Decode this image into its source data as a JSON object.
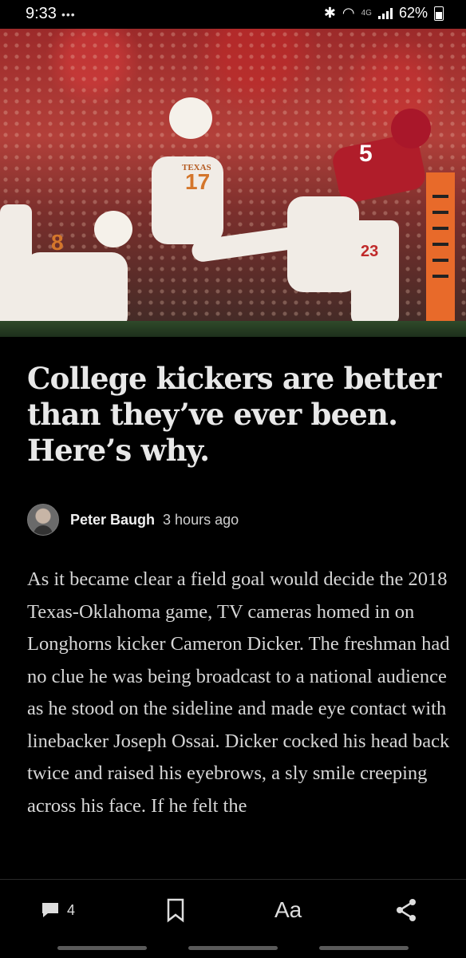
{
  "status_bar": {
    "time": "9:33",
    "notification_dots": "•••",
    "network": "4G",
    "battery": "62%"
  },
  "hero": {
    "description_icons": [
      "football-field-goal-photo"
    ],
    "jersey_numbers": [
      "17",
      "8",
      "5",
      "23"
    ],
    "jersey_text": "TEXAS"
  },
  "article": {
    "headline": "College kickers are better than they’ve ever been. Here’s why.",
    "author": "Peter Baugh",
    "time_ago": "3 hours ago",
    "body": "As it became clear a field goal would decide the 2018 Texas-Oklahoma game, TV cameras homed in on Longhorns kicker Cameron Dicker. The freshman had no clue he was being broadcast to a national audience as he stood on the sideline and made eye contact with linebacker Joseph Ossai. Dicker cocked his head back twice and raised his eyebrows, a sly smile creeping across his face. If he felt the"
  },
  "bottom_bar": {
    "comments_count": "4",
    "font_label": "Aa",
    "icons": [
      "comment-icon",
      "bookmark-icon",
      "font-size-icon",
      "share-icon"
    ]
  },
  "colors": {
    "background": "#000000",
    "headline": "#e8e8e8",
    "body": "#d6d6d6",
    "crowd_red": "#b3403a"
  }
}
